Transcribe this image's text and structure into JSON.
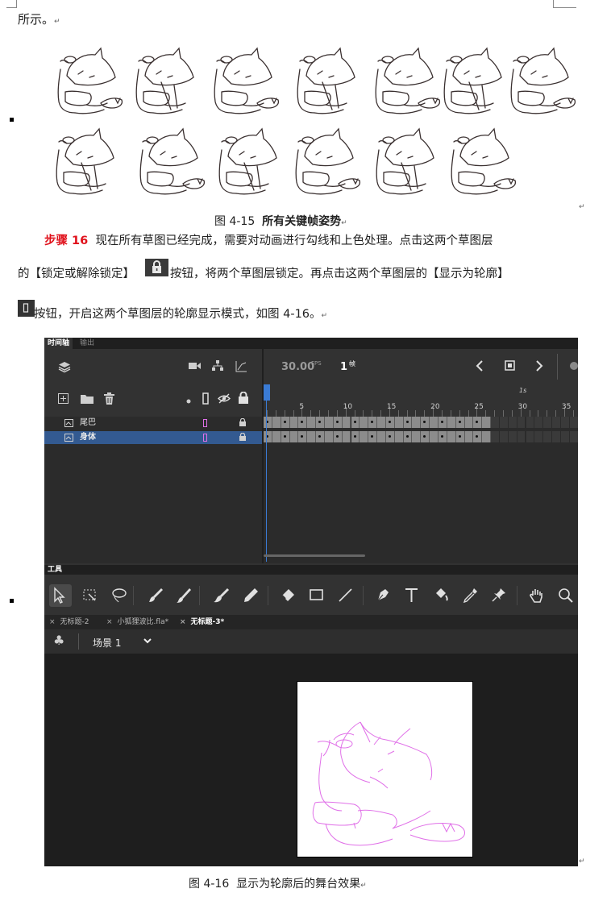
{
  "doc": {
    "line0": "所示。",
    "fig15_caption_num": "图 4-15",
    "fig15_caption_text": "所有关键帧姿势",
    "step_label": "步骤 16",
    "step_text": "现在所有草图已经完成，需要对动画进行勾线和上色处理。点击这两个草图层",
    "line2_a": "的【锁定或解除锁定】",
    "line2_b": "按钮，将两个草图层锁定。再点击这两个草图层的【显示为轮廓】",
    "line3": "按钮，开启这两个草图层的轮廓显示模式，如图 4-16。",
    "fig16_caption_num": "图 4-16",
    "fig16_caption_text": "显示为轮廓后的舞台效果",
    "return_mark": "↵"
  },
  "colors": {
    "step_label": "#e0111b",
    "outline": "#e070e8",
    "selected_layer": "#335a91",
    "playhead": "#3a7bd5"
  },
  "timeline": {
    "tabs": [
      "时间轴",
      "输出"
    ],
    "fps_value": "30.00",
    "fps_unit": "FPS",
    "current_frame": "1",
    "frame_unit": "帧",
    "ruler_labels": [
      "5",
      "10",
      "15",
      "20",
      "25",
      "30",
      "35"
    ],
    "seconds_label": "1s",
    "layers": [
      {
        "name": "尾巴",
        "selected": false
      },
      {
        "name": "身体",
        "selected": true
      }
    ],
    "filled_frames": 26
  },
  "tools": {
    "title": "工具",
    "icons": [
      "selection-tool-icon",
      "free-transform-icon",
      "lasso-icon",
      "fluid-brush-icon",
      "brush-icon",
      "paint-brush-icon",
      "pencil-icon",
      "eraser-icon",
      "rectangle-icon",
      "line-icon",
      "pen-icon",
      "text-icon",
      "paint-bucket-icon",
      "eyedropper-icon",
      "pin-icon",
      "hand-icon",
      "zoom-icon"
    ]
  },
  "doc_tabs": [
    {
      "close": "×",
      "label": "无标题-2"
    },
    {
      "close": "×",
      "label": "小狐狸波比.fla*"
    },
    {
      "close": "×",
      "label": "无标题-3*"
    }
  ],
  "scene": {
    "label": "场景 1"
  }
}
